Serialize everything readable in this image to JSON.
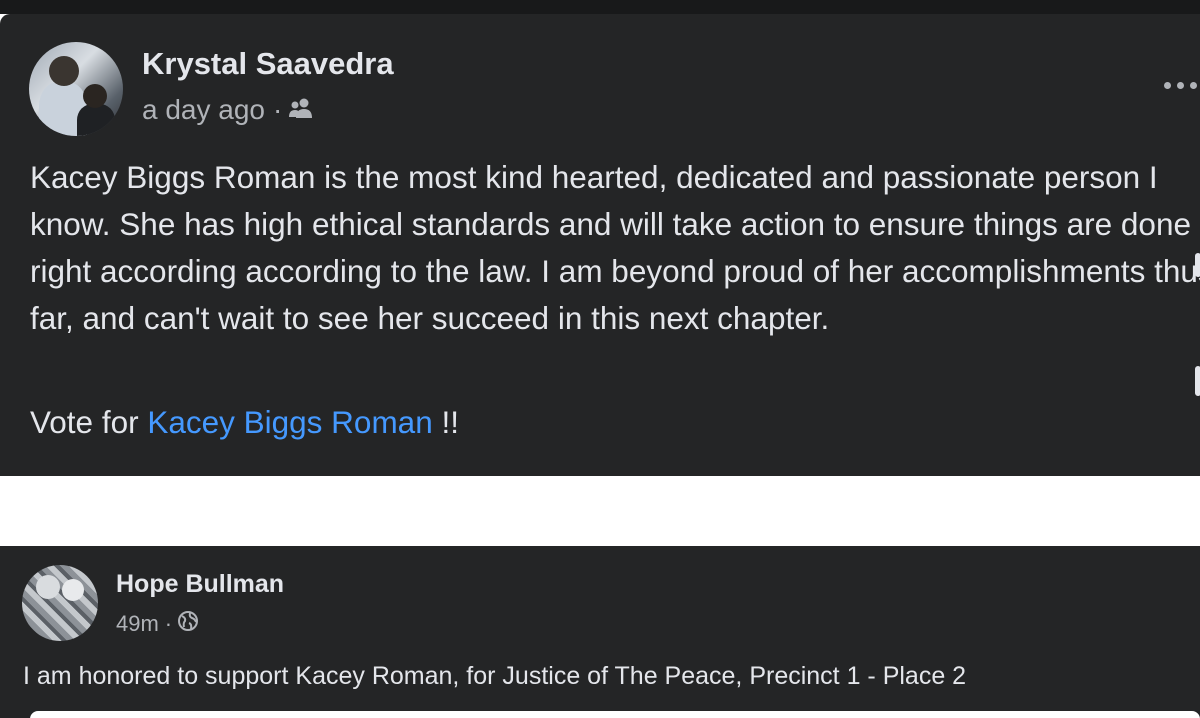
{
  "posts": [
    {
      "author": "Krystal Saavedra",
      "time": "a day ago",
      "separator": "·",
      "audience_icon": "friends-icon",
      "body": "Kacey Biggs Roman is the most kind hearted, dedicated and passionate person I know. She has high ethical standards and will take action to ensure things are done right according according to the law. I am beyond proud of her accomplishments thus far, and can't wait to see her succeed in this next chapter.",
      "vote_prefix": "Vote for ",
      "vote_link": "Kacey Biggs Roman",
      "vote_suffix": " !!"
    },
    {
      "author": "Hope Bullman",
      "time": "49m",
      "separator": "·",
      "audience_icon": "globe-icon",
      "body": "I am honored to support Kacey Roman, for Justice of The Peace, Precinct 1 - Place 2"
    }
  ],
  "colors": {
    "card_background": "#242526",
    "text_primary": "#e4e6eb",
    "text_secondary": "#b0b3b8",
    "link": "#4599ff"
  }
}
